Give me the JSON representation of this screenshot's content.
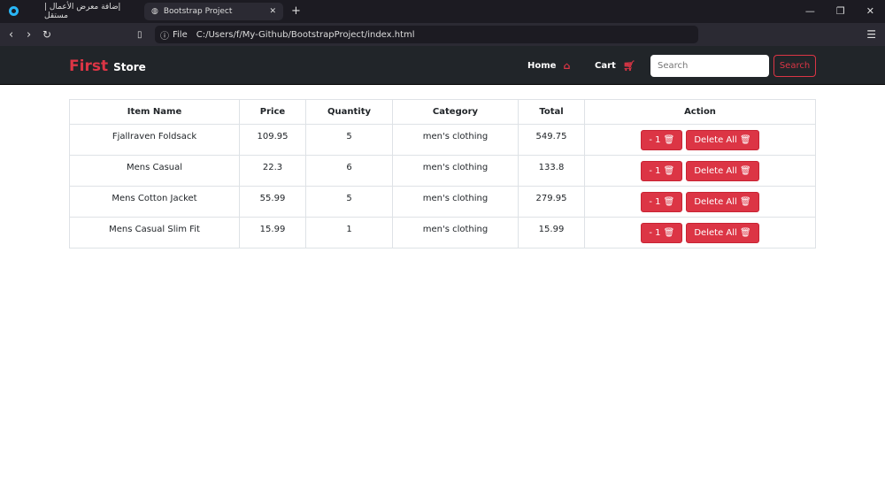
{
  "browser": {
    "tabs": [
      {
        "label": "إضافة معرض الأعمال | مستقل"
      },
      {
        "label": "Bootstrap Project",
        "close": "✕"
      }
    ],
    "new_tab": "+",
    "url_label": "File",
    "url": "C:/Users/f/My-Github/BootstrapProject/index.html"
  },
  "navbar": {
    "brand_first": "First",
    "brand_second": "Store",
    "home": "Home",
    "cart": "Cart",
    "search_placeholder": "Search",
    "search_button": "Search"
  },
  "table": {
    "headers": [
      "Item Name",
      "Price",
      "Quantity",
      "Category",
      "Total",
      "Action"
    ],
    "rows": [
      {
        "name": "Fjallraven Foldsack",
        "price": "109.95",
        "qty": "5",
        "category": "men's clothing",
        "total": "549.75"
      },
      {
        "name": "Mens Casual",
        "price": "22.3",
        "qty": "6",
        "category": "men's clothing",
        "total": "133.8"
      },
      {
        "name": "Mens Cotton Jacket",
        "price": "55.99",
        "qty": "5",
        "category": "men's clothing",
        "total": "279.95"
      },
      {
        "name": "Mens Casual Slim Fit",
        "price": "15.99",
        "qty": "1",
        "category": "men's clothing",
        "total": "15.99"
      }
    ],
    "minus_label": "- 1",
    "delete_all_label": "Delete All"
  },
  "colors": {
    "accent": "#dc3545",
    "navbar": "#212529"
  }
}
